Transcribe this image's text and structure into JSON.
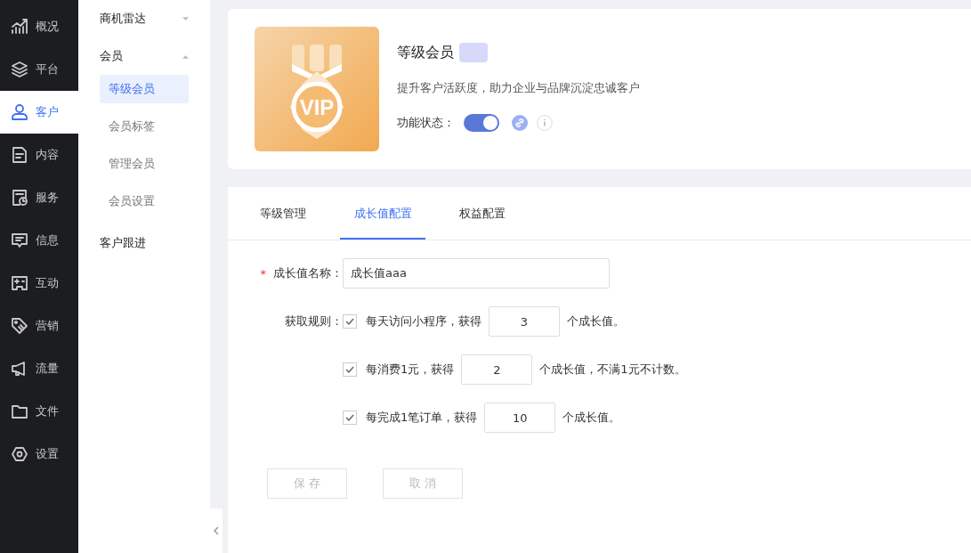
{
  "nav": [
    {
      "label": "概况",
      "selected": false
    },
    {
      "label": "平台",
      "selected": false
    },
    {
      "label": "客户",
      "selected": true
    },
    {
      "label": "内容",
      "selected": false
    },
    {
      "label": "服务",
      "selected": false
    },
    {
      "label": "信息",
      "selected": false
    },
    {
      "label": "互动",
      "selected": false
    },
    {
      "label": "营销",
      "selected": false
    },
    {
      "label": "流量",
      "selected": false
    },
    {
      "label": "文件",
      "selected": false
    },
    {
      "label": "设置",
      "selected": false
    }
  ],
  "submenu": [
    {
      "label": "商机雷达",
      "expanded": false
    },
    {
      "label": "会员",
      "expanded": true,
      "children": [
        {
          "label": "等级会员",
          "selected": true
        },
        {
          "label": "会员标签",
          "selected": false
        },
        {
          "label": "管理会员",
          "selected": false
        },
        {
          "label": "会员设置",
          "selected": false
        }
      ]
    },
    {
      "label": "客户跟进"
    }
  ],
  "header": {
    "badge_text": "VIP",
    "title": "等级会员",
    "description": "提升客户活跃度，助力企业与品牌沉淀忠诚客户",
    "status_label": "功能状态：",
    "status_on": true
  },
  "tabs": [
    {
      "label": "等级管理",
      "selected": false
    },
    {
      "label": "成长值配置",
      "selected": true
    },
    {
      "label": "权益配置",
      "selected": false
    }
  ],
  "form": {
    "required_mark": "*",
    "name_label": "成长值名称：",
    "name_value": "成长值aaa",
    "rules_label": "获取规则：",
    "rules": [
      {
        "checked": true,
        "before": "每天访问小程序，获得",
        "value": "3",
        "after": "个成长值。"
      },
      {
        "checked": true,
        "before": "每消费1元，获得",
        "value": "2",
        "after": "个成长值，不满1元不计数。"
      },
      {
        "checked": true,
        "before": "每完成1笔订单，获得",
        "value": "10",
        "after": "个成长值。"
      }
    ]
  },
  "buttons": [
    {
      "label": "保 存",
      "disabled": true
    },
    {
      "label": "取 消",
      "disabled": true
    }
  ]
}
